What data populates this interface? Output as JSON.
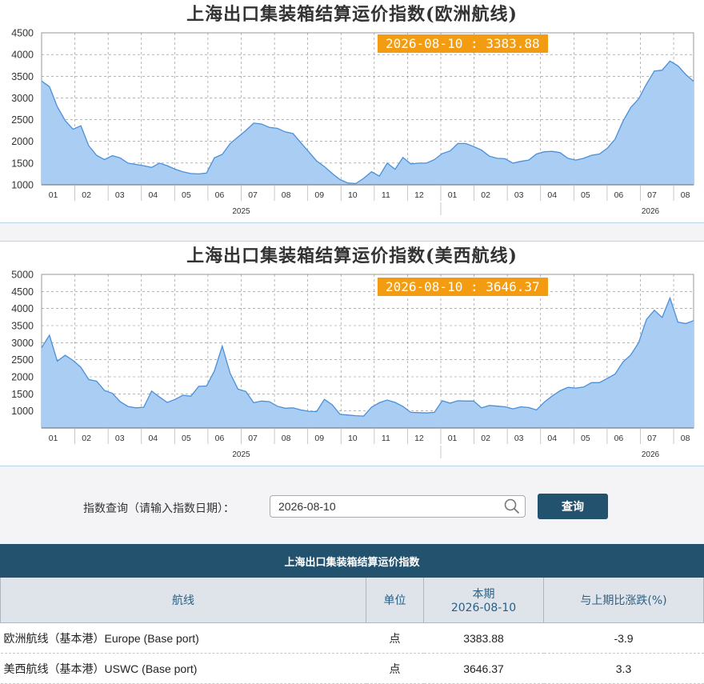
{
  "colors": {
    "area_fill": "#a9cdf3",
    "area_line": "#4a90d9",
    "readout_bg": "#f39c12",
    "header_bg": "#23526f",
    "grid": "#888888"
  },
  "months": [
    "01",
    "02",
    "03",
    "04",
    "05",
    "06",
    "07",
    "08",
    "09",
    "10",
    "11",
    "12",
    "01",
    "02",
    "03",
    "04",
    "05",
    "06",
    "07",
    "08"
  ],
  "charts": {
    "eu": {
      "title": "上海出口集装箱结算运价指数(欧洲航线)",
      "readout": "2026-08-10 : 3383.88",
      "chart_data": {
        "type": "area",
        "ylim": [
          1000,
          4500
        ],
        "yticks": [
          1000,
          1500,
          2000,
          2500,
          3000,
          3500,
          4000,
          4500
        ],
        "year_labels": [
          "2025",
          "2026"
        ],
        "grid": true,
        "x_unit": "weeks starting 2025-01-03",
        "values": [
          3390,
          3260,
          2800,
          2480,
          2280,
          2360,
          1900,
          1680,
          1580,
          1670,
          1620,
          1500,
          1470,
          1440,
          1400,
          1500,
          1440,
          1360,
          1300,
          1260,
          1250,
          1270,
          1620,
          1700,
          1950,
          2100,
          2250,
          2420,
          2400,
          2320,
          2300,
          2220,
          2180,
          1970,
          1760,
          1550,
          1420,
          1260,
          1120,
          1040,
          1030,
          1150,
          1300,
          1200,
          1500,
          1360,
          1630,
          1480,
          1500,
          1500,
          1580,
          1720,
          1780,
          1950,
          1950,
          1880,
          1800,
          1660,
          1610,
          1600,
          1500,
          1540,
          1570,
          1710,
          1760,
          1770,
          1740,
          1610,
          1570,
          1610,
          1680,
          1710,
          1840,
          2050,
          2460,
          2780,
          2980,
          3320,
          3620,
          3640,
          3850,
          3740,
          3540,
          3384
        ]
      }
    },
    "us": {
      "title": "上海出口集装箱结算运价指数(美西航线)",
      "readout": "2026-08-10 : 3646.37",
      "chart_data": {
        "type": "area",
        "ylim": [
          500,
          5000
        ],
        "yticks": [
          1000,
          1500,
          2000,
          2500,
          3000,
          3500,
          4000,
          4500,
          5000
        ],
        "year_labels": [
          "2025",
          "2026"
        ],
        "grid": true,
        "x_unit": "weeks starting 2025-01-03",
        "values": [
          2850,
          3220,
          2460,
          2630,
          2480,
          2280,
          1920,
          1870,
          1600,
          1520,
          1270,
          1130,
          1090,
          1110,
          1580,
          1410,
          1250,
          1340,
          1460,
          1430,
          1720,
          1730,
          2170,
          2900,
          2100,
          1640,
          1570,
          1240,
          1290,
          1270,
          1140,
          1080,
          1090,
          1030,
          990,
          980,
          1340,
          1180,
          900,
          880,
          860,
          850,
          1110,
          1240,
          1320,
          1250,
          1130,
          960,
          950,
          940,
          960,
          1300,
          1230,
          1300,
          1290,
          1290,
          1090,
          1160,
          1140,
          1120,
          1060,
          1120,
          1100,
          1030,
          1260,
          1440,
          1590,
          1690,
          1670,
          1700,
          1830,
          1830,
          1950,
          2080,
          2430,
          2640,
          3000,
          3680,
          3950,
          3740,
          4310,
          3600,
          3560,
          3646
        ]
      }
    }
  },
  "search": {
    "label": "指数查询（请输入指数日期）：",
    "value": "2026-08-10",
    "button_label": "查询"
  },
  "table": {
    "title": "上海出口集装箱结算运价指数",
    "headers": {
      "route": "航线",
      "unit": "单位",
      "current": "本期",
      "current_date": "2026-08-10",
      "change": "与上期比涨跌(%)"
    },
    "rows": [
      {
        "route": "欧洲航线（基本港）Europe (Base port)",
        "unit": "点",
        "value": "3383.88",
        "change": "-3.9"
      },
      {
        "route": "美西航线（基本港）USWC (Base port)",
        "unit": "点",
        "value": "3646.37",
        "change": "3.3"
      }
    ]
  }
}
